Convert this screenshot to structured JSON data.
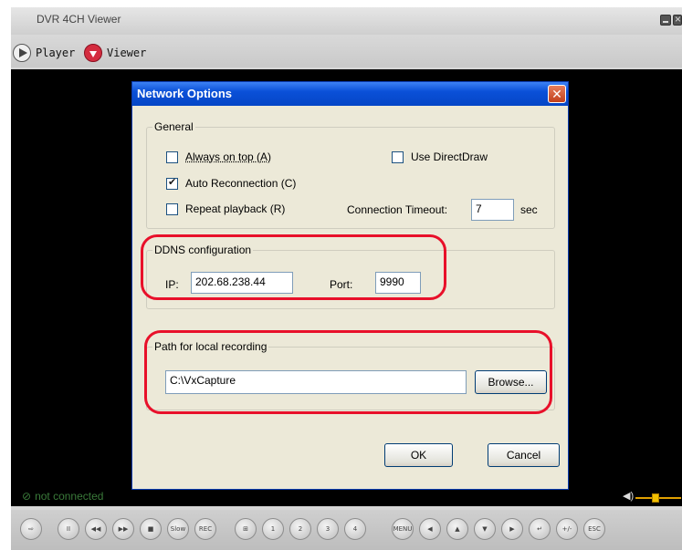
{
  "app": {
    "title": "DVR 4CH Viewer",
    "mode_player": "Player",
    "mode_viewer": "Viewer",
    "status": "not connected"
  },
  "colors": {
    "dialog_title_bg": "#0a50d8",
    "highlight": "#e8102a",
    "status_text": "#3a7a3a",
    "video_bg": "#000000"
  },
  "dialog": {
    "title": "Network Options",
    "general": {
      "legend": "General",
      "always_on_top": {
        "label": "Always on top (A)",
        "checked": false
      },
      "use_directdraw": {
        "label": "Use DirectDraw",
        "checked": false
      },
      "auto_reconnection": {
        "label": "Auto Reconnection (C)",
        "checked": true
      },
      "repeat_playback": {
        "label": "Repeat playback (R)",
        "checked": false
      },
      "timeout_label": "Connection Timeout:",
      "timeout_value": "7",
      "timeout_unit": "sec"
    },
    "ddns": {
      "legend": "DDNS configuration",
      "ip_label": "IP:",
      "ip_value": "202.68.238.44",
      "port_label": "Port:",
      "port_value": "9990"
    },
    "recording": {
      "legend": "Path for local recording",
      "path_value": "C:\\VxCapture",
      "browse_label": "Browse..."
    },
    "ok_label": "OK",
    "cancel_label": "Cancel"
  },
  "controls": [
    {
      "name": "exit-button",
      "glyph": "⇨"
    },
    {
      "name": "pause-button",
      "glyph": "II"
    },
    {
      "name": "rewind-button",
      "glyph": "◀◀"
    },
    {
      "name": "fast-forward-button",
      "glyph": "▶▶"
    },
    {
      "name": "stop-button",
      "glyph": "■"
    },
    {
      "name": "slow-button",
      "glyph": "Slow"
    },
    {
      "name": "rec-button",
      "glyph": "REC"
    },
    {
      "name": "layout-quad-button",
      "glyph": "⊞"
    },
    {
      "name": "channel-1-button",
      "glyph": "1"
    },
    {
      "name": "channel-2-button",
      "glyph": "2"
    },
    {
      "name": "channel-3-button",
      "glyph": "3"
    },
    {
      "name": "channel-4-button",
      "glyph": "4"
    },
    {
      "name": "menu-button",
      "glyph": "MENU"
    },
    {
      "name": "ptz-left-button",
      "glyph": "◀"
    },
    {
      "name": "ptz-up-button",
      "glyph": "▲"
    },
    {
      "name": "ptz-down-button",
      "glyph": "▼"
    },
    {
      "name": "ptz-right-button",
      "glyph": "▶"
    },
    {
      "name": "ptz-enter-button",
      "glyph": "↵"
    },
    {
      "name": "ptz-zoom-button",
      "glyph": "+/-"
    },
    {
      "name": "exit-menu-button",
      "glyph": "ESC"
    }
  ]
}
